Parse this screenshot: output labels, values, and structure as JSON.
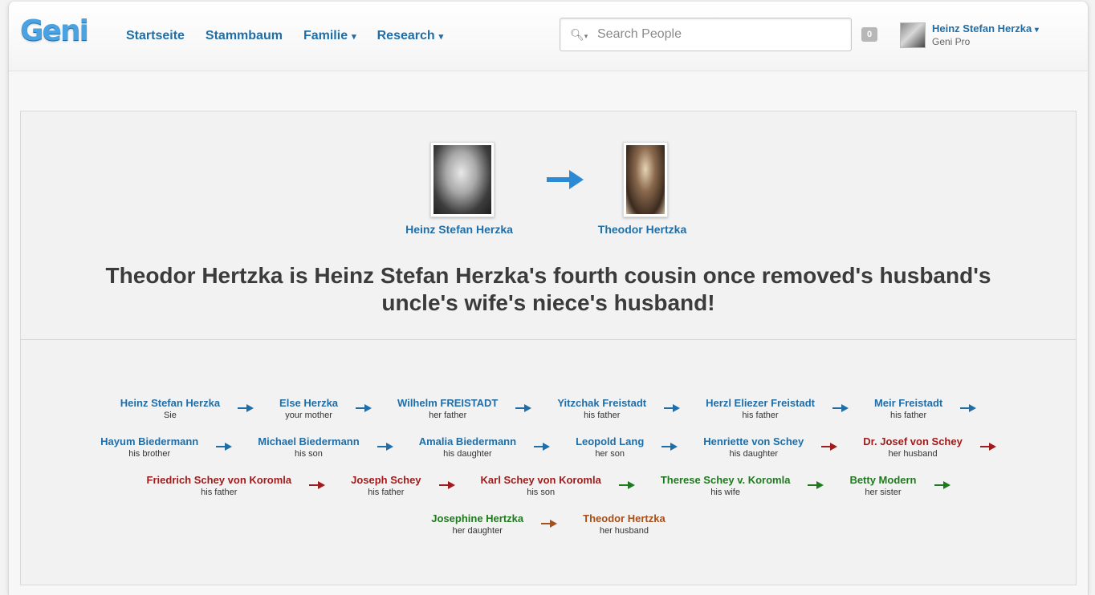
{
  "app": {
    "logo": "Geni"
  },
  "nav": {
    "items": [
      {
        "label": "Startseite",
        "dropdown": false
      },
      {
        "label": "Stammbaum",
        "dropdown": false
      },
      {
        "label": "Familie",
        "dropdown": true
      },
      {
        "label": "Research",
        "dropdown": true
      }
    ]
  },
  "search": {
    "placeholder": "Search People"
  },
  "header": {
    "notifications_count": "0",
    "user_name": "Heinz Stefan Herzka",
    "user_plan": "Geni Pro"
  },
  "relationship": {
    "from_name": "Heinz Stefan Herzka",
    "to_name": "Theodor Hertzka",
    "headline_line1": "Theodor Hertzka is Heinz Stefan Herzka's fourth cousin once removed's husband's",
    "headline_line2": "uncle's wife's niece's husband!"
  },
  "colors": {
    "blue": "#1f6ea8",
    "red": "#a01c1c",
    "green": "#1f7a1f",
    "brown": "#a84f1a",
    "hero_arrow": "#2a8ad6"
  },
  "chain_rows": [
    [
      {
        "name": "Heinz Stefan Herzka",
        "relation": "Sie",
        "color": "blue",
        "arrow": "blue"
      },
      {
        "name": "Else Herzka",
        "relation": "your mother",
        "color": "blue",
        "arrow": "blue"
      },
      {
        "name": "Wilhelm FREISTADT",
        "relation": "her father",
        "color": "blue",
        "arrow": "blue"
      },
      {
        "name": "Yitzchak Freistadt",
        "relation": "his father",
        "color": "blue",
        "arrow": "blue"
      },
      {
        "name": "Herzl Eliezer Freistadt",
        "relation": "his father",
        "color": "blue",
        "arrow": "blue"
      },
      {
        "name": "Meir Freistadt",
        "relation": "his father",
        "color": "blue",
        "arrow": "blue"
      }
    ],
    [
      {
        "name": "Hayum Biedermann",
        "relation": "his brother",
        "color": "blue",
        "arrow": "blue"
      },
      {
        "name": "Michael Biedermann",
        "relation": "his son",
        "color": "blue",
        "arrow": "blue"
      },
      {
        "name": "Amalia Biedermann",
        "relation": "his daughter",
        "color": "blue",
        "arrow": "blue"
      },
      {
        "name": "Leopold Lang",
        "relation": "her son",
        "color": "blue",
        "arrow": "blue"
      },
      {
        "name": "Henriette von Schey",
        "relation": "his daughter",
        "color": "blue",
        "arrow": "red"
      },
      {
        "name": "Dr. Josef von Schey",
        "relation": "her husband",
        "color": "red",
        "arrow": "red"
      }
    ],
    [
      {
        "name": "Friedrich Schey von Koromla",
        "relation": "his father",
        "color": "red",
        "arrow": "red"
      },
      {
        "name": "Joseph Schey",
        "relation": "his father",
        "color": "red",
        "arrow": "red"
      },
      {
        "name": "Karl Schey von Koromla",
        "relation": "his son",
        "color": "red",
        "arrow": "green"
      },
      {
        "name": "Therese Schey v. Koromla",
        "relation": "his wife",
        "color": "green",
        "arrow": "green"
      },
      {
        "name": "Betty Modern",
        "relation": "her sister",
        "color": "green",
        "arrow": "green"
      }
    ],
    [
      {
        "name": "Josephine Hertzka",
        "relation": "her daughter",
        "color": "green",
        "arrow": "brown"
      },
      {
        "name": "Theodor Hertzka",
        "relation": "her husband",
        "color": "brown",
        "arrow": null
      }
    ]
  ]
}
